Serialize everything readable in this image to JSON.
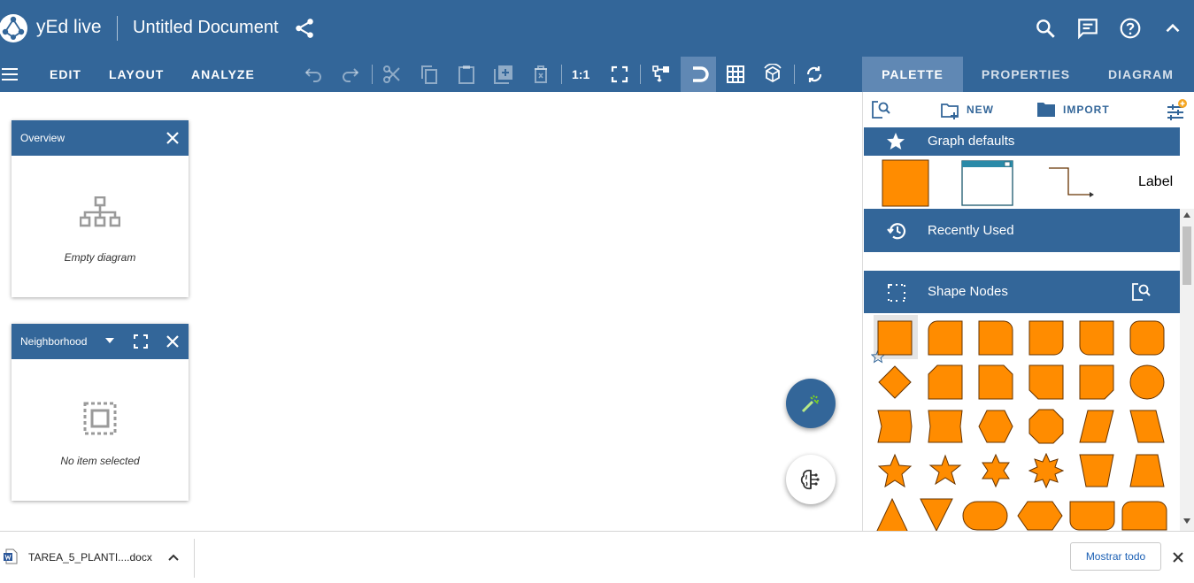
{
  "app": {
    "name": "yEd live",
    "document_title": "Untitled Document"
  },
  "toolbar": {
    "menu": [
      "EDIT",
      "LAYOUT",
      "ANALYZE"
    ],
    "zoom_label": "1:1"
  },
  "right_tabs": [
    {
      "label": "PALETTE",
      "active": true
    },
    {
      "label": "PROPERTIES",
      "active": false
    },
    {
      "label": "DIAGRAM",
      "active": false
    }
  ],
  "overview_panel": {
    "title": "Overview",
    "message": "Empty diagram"
  },
  "neighborhood_panel": {
    "title": "Neighborhood",
    "message": "No item selected"
  },
  "palette": {
    "new_label": "NEW",
    "import_label": "IMPORT",
    "sections": {
      "graph_defaults": "Graph defaults",
      "recently_used": "Recently Used",
      "shape_nodes": "Shape Nodes"
    },
    "graph_defaults_label": "Label",
    "shape_fill": "#ff8c00",
    "shape_stroke": "#663300"
  },
  "download_bar": {
    "file_name": "TAREA_5_PLANTI....docx",
    "show_all": "Mostrar todo"
  },
  "colors": {
    "primary": "#336699",
    "active_tab": "#6088b4",
    "orange": "#ff8c00"
  }
}
